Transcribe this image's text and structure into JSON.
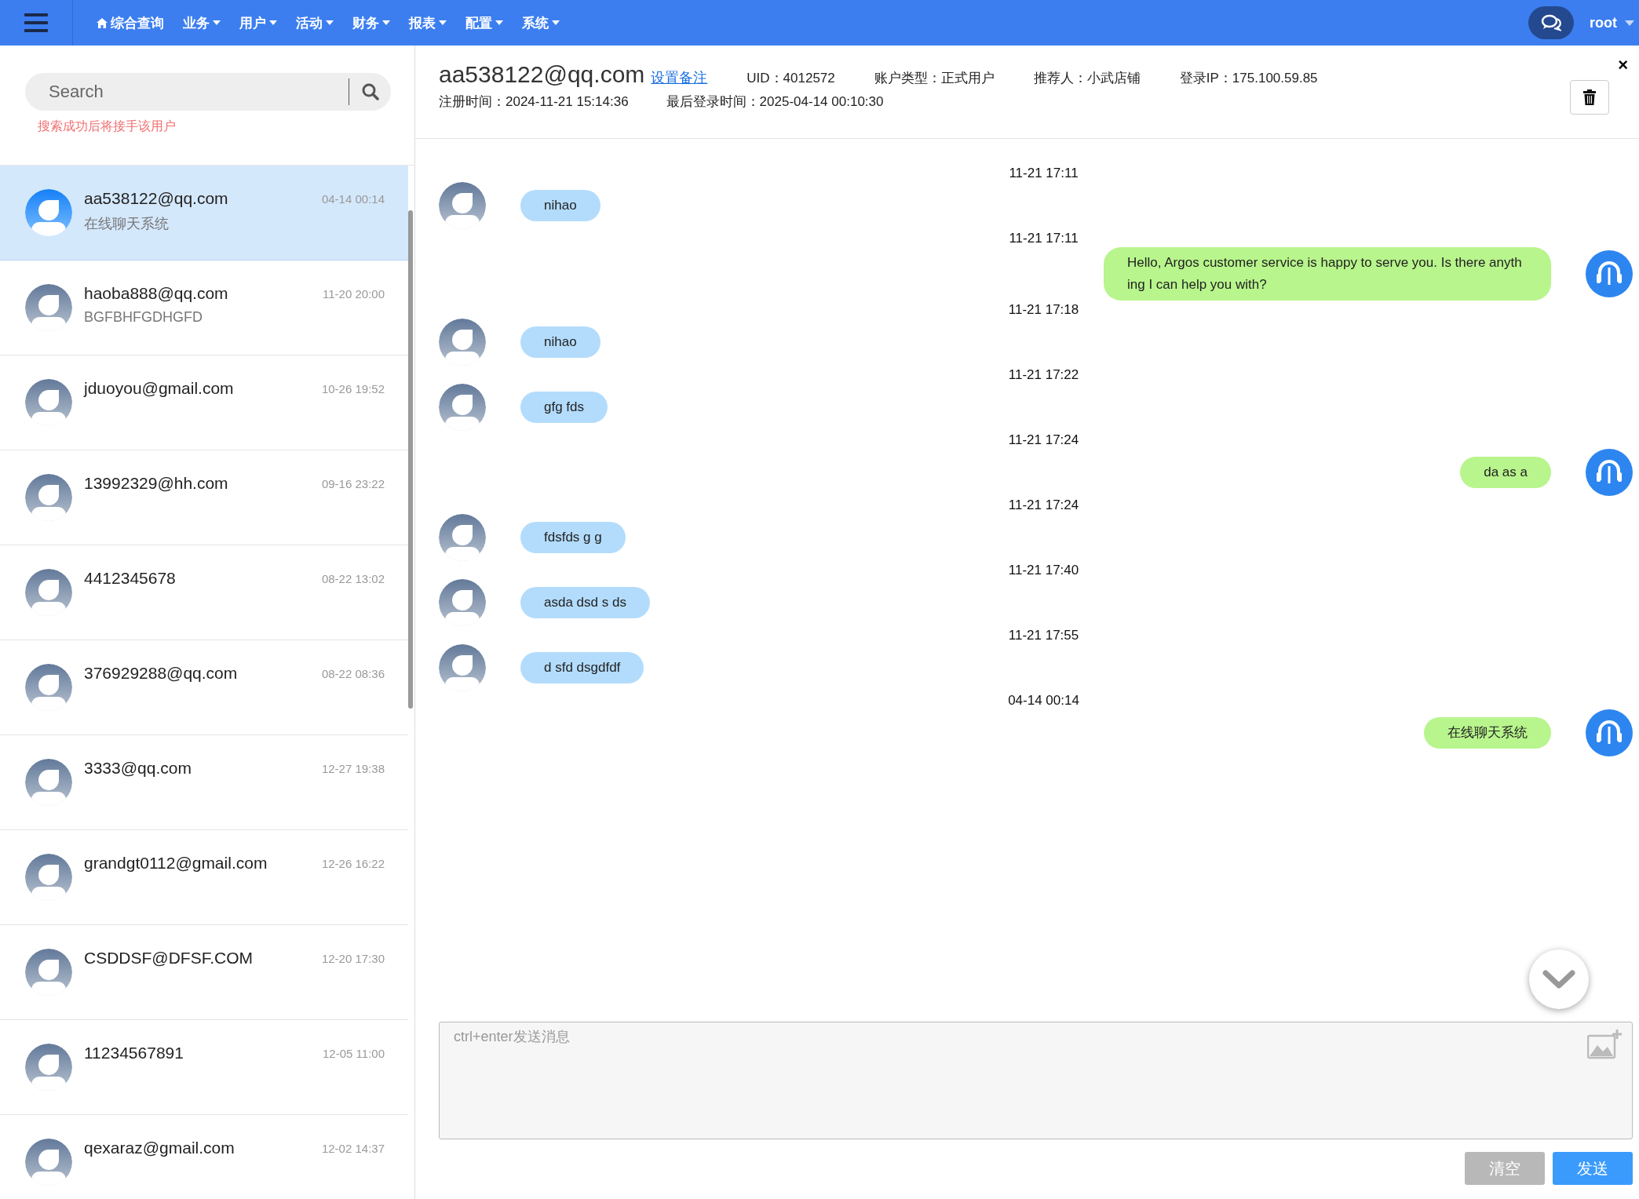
{
  "nav": {
    "items": [
      {
        "label": "综合查询",
        "kind": "home"
      },
      {
        "label": "业务",
        "kind": "menu"
      },
      {
        "label": "用户",
        "kind": "menu"
      },
      {
        "label": "活动",
        "kind": "menu"
      },
      {
        "label": "财务",
        "kind": "menu"
      },
      {
        "label": "报表",
        "kind": "menu"
      },
      {
        "label": "配置",
        "kind": "menu"
      },
      {
        "label": "系统",
        "kind": "menu"
      }
    ],
    "user": "root"
  },
  "search": {
    "placeholder": "Search",
    "hint": "搜索成功后将接手该用户"
  },
  "contacts": [
    {
      "name": "aa538122@qq.com",
      "time": "04-14 00:14",
      "preview": "在线聊天系统",
      "selected": true
    },
    {
      "name": "haoba888@qq.com",
      "time": "11-20 20:00",
      "preview": "BGFBHFGDHGFD",
      "selected": false
    },
    {
      "name": "jduoyou@gmail.com",
      "time": "10-26 19:52",
      "selected": false
    },
    {
      "name": "13992329@hh.com",
      "time": "09-16 23:22",
      "selected": false
    },
    {
      "name": "4412345678",
      "time": "08-22 13:02",
      "selected": false
    },
    {
      "name": "376929288@qq.com",
      "time": "08-22 08:36",
      "selected": false
    },
    {
      "name": "3333@qq.com",
      "time": "12-27 19:38",
      "selected": false
    },
    {
      "name": "grandgt0112@gmail.com",
      "time": "12-26 16:22",
      "selected": false
    },
    {
      "name": "CSDDSF@DFSF.COM",
      "time": "12-20 17:30",
      "selected": false
    },
    {
      "name": "11234567891",
      "time": "12-05 11:00",
      "selected": false
    },
    {
      "name": "qexaraz@gmail.com",
      "time": "12-02 14:37",
      "selected": false
    }
  ],
  "chat_header": {
    "email": "aa538122@qq.com",
    "remark_link": "设置备注",
    "fields": [
      "UID：4012572",
      "账户类型：正式用户",
      "推荐人：小武店铺",
      "登录IP：175.100.59.85"
    ],
    "fields_2": [
      "注册时间：2024-11-21 15:14:36",
      "最后登录时间：2025-04-14 00:10:30"
    ],
    "close": "×"
  },
  "messages": [
    {
      "time": "11-21 17:11",
      "kind": "incoming",
      "text": "nihao"
    },
    {
      "time": "11-21 17:11",
      "kind": "outgoing",
      "text": "Hello, Argos customer service is happy to serve you. Is there anyth ing I can help you with?"
    },
    {
      "time": "11-21 17:18",
      "kind": "incoming",
      "text": "nihao"
    },
    {
      "time": "11-21 17:22",
      "kind": "incoming",
      "text": "gfg fds"
    },
    {
      "time": "11-21 17:24",
      "kind": "outgoing",
      "text": "da as a"
    },
    {
      "time": "11-21 17:24",
      "kind": "incoming",
      "text": "fdsfds g g"
    },
    {
      "time": "11-21 17:40",
      "kind": "incoming",
      "text": "asda dsd s ds"
    },
    {
      "time": "11-21 17:55",
      "kind": "incoming",
      "text": "d sfd dsgdfdf"
    },
    {
      "time": "04-14 00:14",
      "kind": "outgoing",
      "text": "在线聊天系统"
    }
  ],
  "composer": {
    "placeholder": "ctrl+enter发送消息",
    "buttons": [
      {
        "label": "清空",
        "kind": "secondary"
      },
      {
        "label": "发送",
        "kind": "primary"
      }
    ]
  }
}
